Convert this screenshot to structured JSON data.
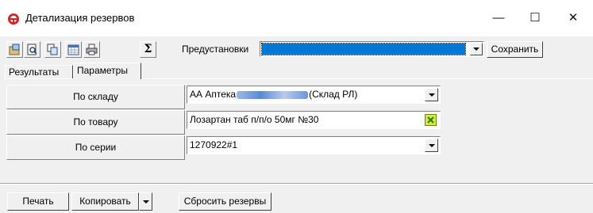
{
  "window": {
    "title": "Детализация резервов",
    "minimize": "—",
    "maximize": "☐",
    "close": "✕"
  },
  "toolbar": {
    "buttons": [
      "properties-icon",
      "preview-icon",
      "copy-icon",
      "calendar-icon",
      "print-icon",
      "sum-icon"
    ],
    "sigma": "Σ",
    "presets_label": "Предустановки",
    "presets_selected_color": "#0078d7",
    "save_label": "Сохранить"
  },
  "tabs": [
    {
      "label": "Результаты",
      "active": false
    },
    {
      "label": "Параметры",
      "active": true
    }
  ],
  "params": [
    {
      "label": "По складу",
      "value_prefix": "АА Аптека",
      "value_suffix": "(Склад РЛ)",
      "control": "dropdown"
    },
    {
      "label": "По товару",
      "value": "Лозартан таб п/п/о 50мг №30",
      "control": "clear-button"
    },
    {
      "label": "По серии",
      "value": "1270922#1",
      "control": "dropdown"
    }
  ],
  "bottom": {
    "print_label": "Печать",
    "copy_label": "Копировать",
    "reset_label": "Сбросить резервы"
  }
}
